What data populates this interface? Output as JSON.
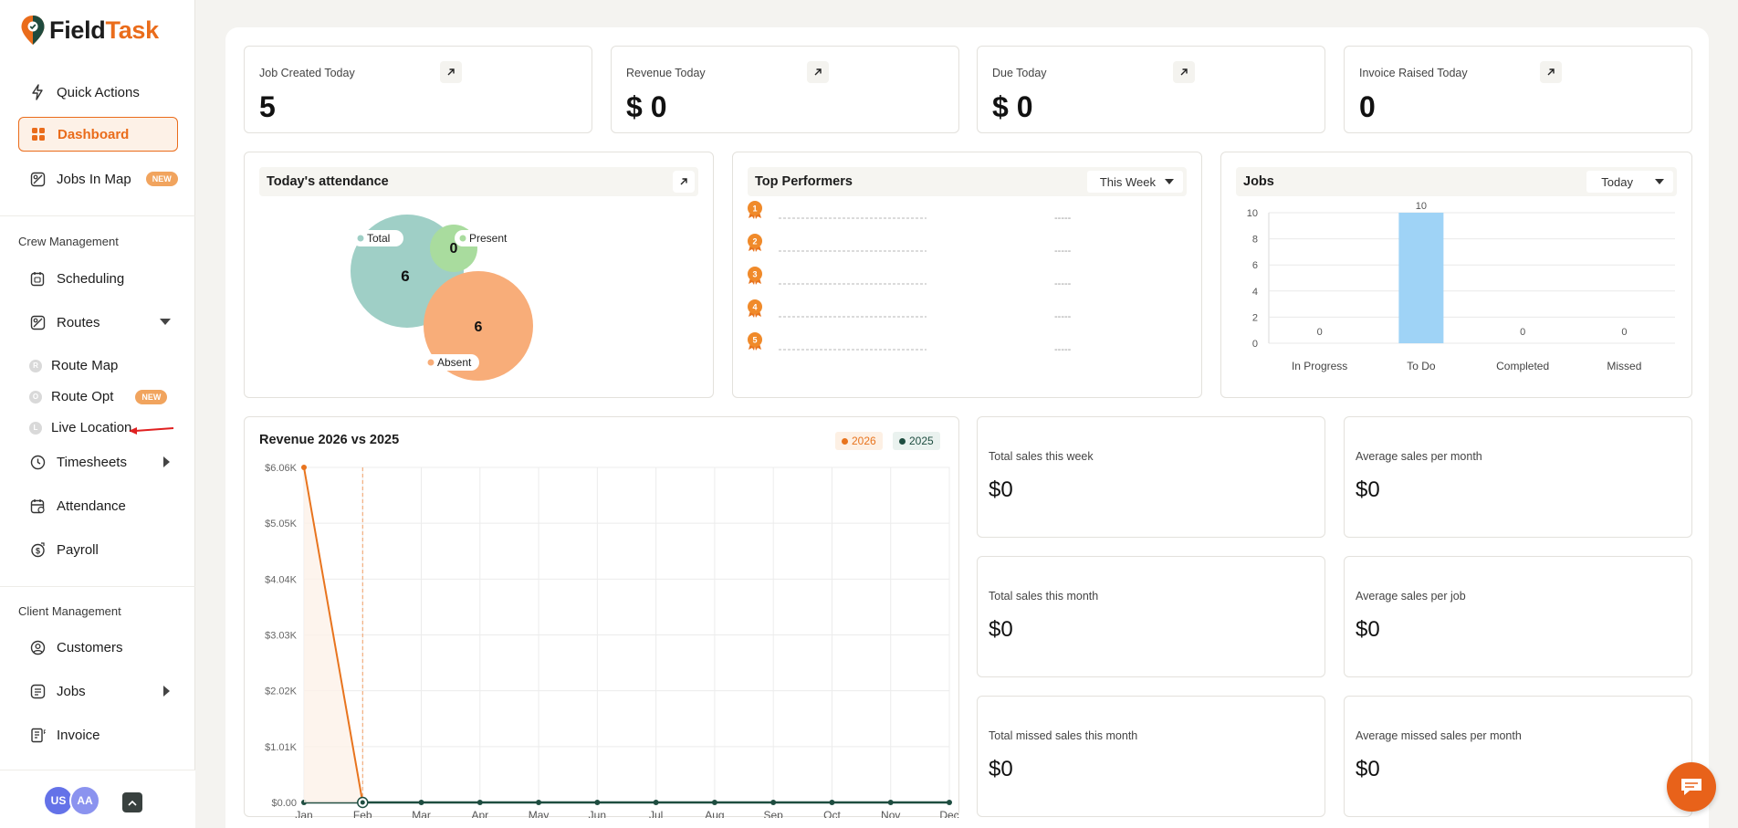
{
  "brand": {
    "part1": "Field",
    "part2": "Task"
  },
  "sidebar": {
    "quick_actions": "Quick Actions",
    "dashboard": "Dashboard",
    "jobs_in_map": "Jobs In Map",
    "new_badge": "NEW",
    "crew_management": "Crew Management",
    "scheduling": "Scheduling",
    "routes": "Routes",
    "route_map": "Route Map",
    "route_opt": "Route Opt",
    "live_location": "Live Location",
    "timesheets": "Timesheets",
    "attendance": "Attendance",
    "payroll": "Payroll",
    "client_management": "Client Management",
    "customers": "Customers",
    "jobs": "Jobs",
    "invoice": "Invoice",
    "avatars": [
      "US",
      "AA"
    ]
  },
  "stats": [
    {
      "title": "Job Created Today",
      "value": "5"
    },
    {
      "title": "Revenue Today",
      "value": "$ 0"
    },
    {
      "title": "Due Today",
      "value": "$ 0"
    },
    {
      "title": "Invoice Raised Today",
      "value": "0"
    }
  ],
  "attendance": {
    "title": "Today's attendance",
    "total_label": "Total",
    "total_value": "6",
    "present_label": "Present",
    "present_value": "0",
    "absent_label": "Absent",
    "absent_value": "6",
    "colors": {
      "total": "#9fcfc6",
      "present": "#a9dc9e",
      "absent": "#f8ad79"
    }
  },
  "top_performers": {
    "title": "Top Performers",
    "filter": "This Week",
    "ranks": [
      "1",
      "2",
      "3",
      "4",
      "5"
    ],
    "placeholder": "-----"
  },
  "jobs_panel": {
    "title": "Jobs",
    "filter": "Today"
  },
  "revenue_panel": {
    "title": "Revenue 2026 vs 2025",
    "legend": [
      {
        "label": "2026",
        "color": "#e8741e"
      },
      {
        "label": "2025",
        "color": "#1e4d40"
      }
    ]
  },
  "summary": [
    {
      "title": "Total sales this week",
      "value": "$0"
    },
    {
      "title": "Average sales per month",
      "value": "$0"
    },
    {
      "title": "Total sales this month",
      "value": "$0"
    },
    {
      "title": "Average sales per job",
      "value": "$0"
    },
    {
      "title": "Total missed sales this month",
      "value": "$0"
    },
    {
      "title": "Average missed sales per month",
      "value": "$0"
    }
  ],
  "chart_data": [
    {
      "type": "bar",
      "title": "Jobs",
      "categories": [
        "In Progress",
        "To Do",
        "Completed",
        "Missed"
      ],
      "values": [
        0,
        10,
        0,
        0
      ],
      "ylim": [
        0,
        10
      ],
      "yticks": [
        0,
        2,
        4,
        6,
        8,
        10
      ],
      "color": "#9fd3f6",
      "grid": true
    },
    {
      "type": "line",
      "title": "Revenue 2026 vs 2025",
      "categories": [
        "Jan",
        "Feb",
        "Mar",
        "Apr",
        "May",
        "Jun",
        "Jul",
        "Aug",
        "Sep",
        "Oct",
        "Nov",
        "Dec"
      ],
      "yticks": [
        "$0.00",
        "$1.01K",
        "$2.02K",
        "$3.03K",
        "$4.04K",
        "$5.05K",
        "$6.06K"
      ],
      "ylim": [
        0,
        6060
      ],
      "series": [
        {
          "name": "2026",
          "color": "#e8741e",
          "values": [
            6060,
            0
          ]
        },
        {
          "name": "2025",
          "color": "#1e4d40",
          "values": [
            0,
            0,
            0,
            0,
            0,
            0,
            0,
            0,
            0,
            0,
            0,
            0
          ]
        }
      ],
      "grid": true
    }
  ]
}
